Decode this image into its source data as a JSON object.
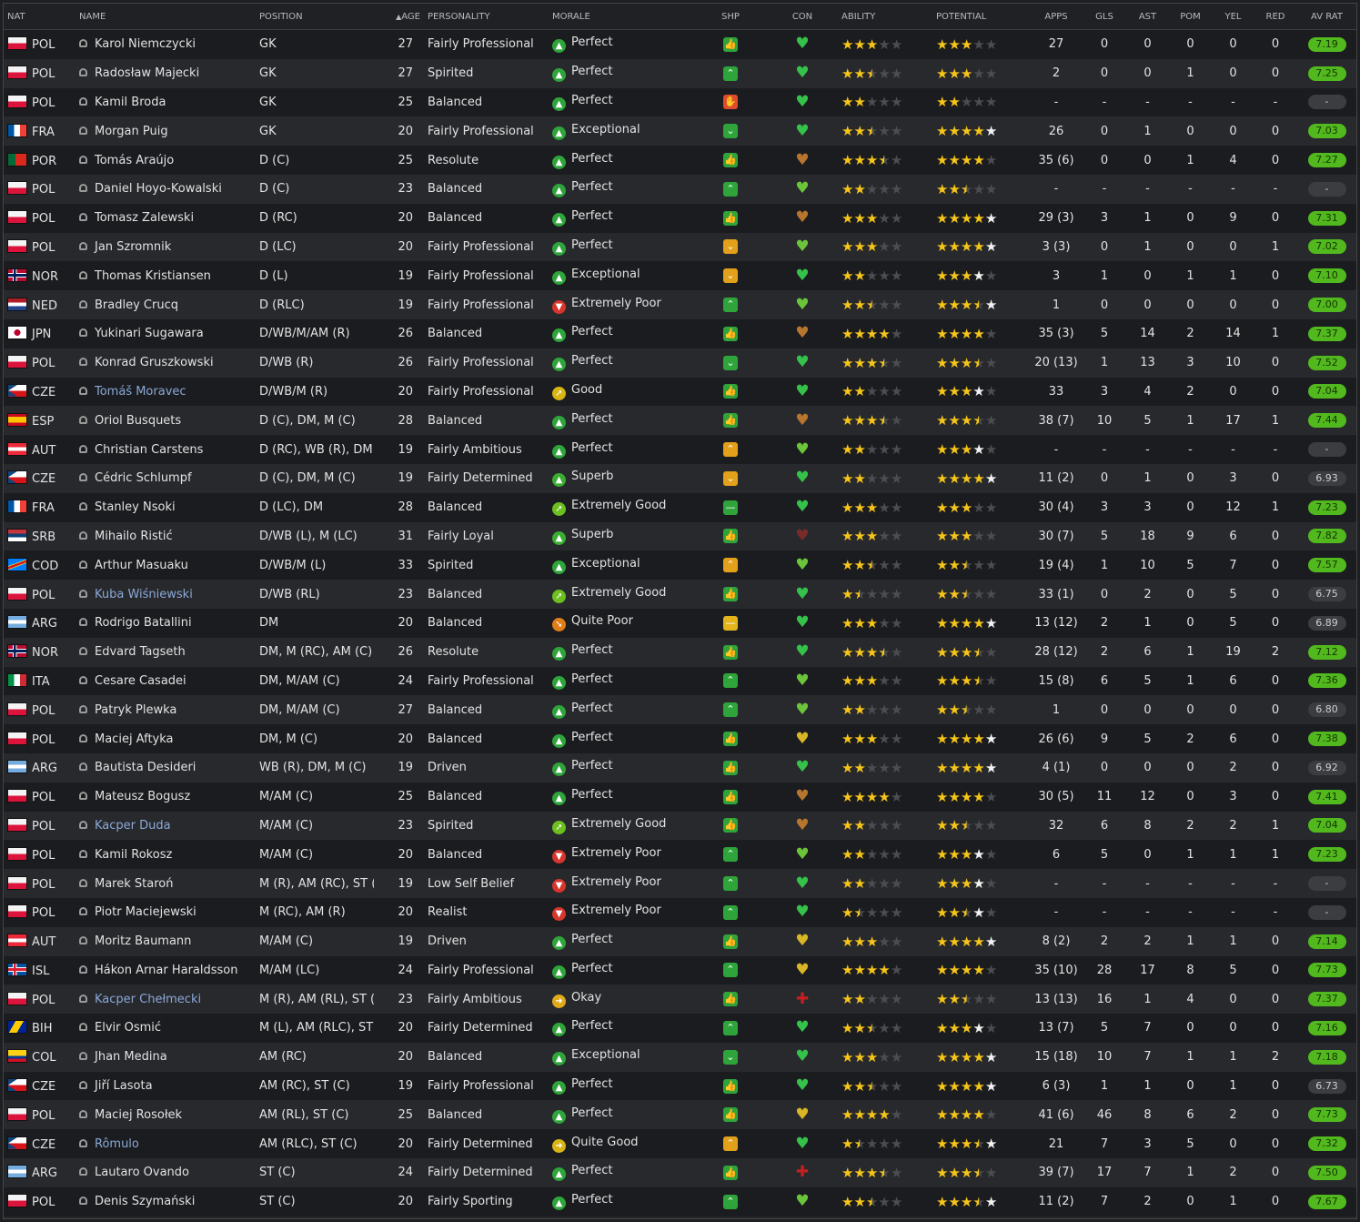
{
  "columns": {
    "nat": "NAT",
    "name": "NAME",
    "position": "POSITION",
    "age_sort_icon": "up-arrow",
    "age": "AGE",
    "personality": "PERSONALITY",
    "morale": "MORALE",
    "shp": "SHP",
    "con": "CON",
    "ability": "ABILITY",
    "potential": "POTENTIAL",
    "apps": "APPS",
    "gls": "GLS",
    "ast": "AST",
    "pom": "POM",
    "yel": "YEL",
    "red": "RED",
    "av_rat": "AV RAT"
  },
  "colors": {
    "accent_green": "#51b81e",
    "star": "#f6c51a",
    "link": "#8aa9d6"
  },
  "players": [
    {
      "nat": "POL",
      "name": "Karol Niemczycki",
      "pos": "GK",
      "age": "27",
      "pers": "Fairly Professional",
      "morale": "Perfect",
      "shp": "thumb",
      "con": "green",
      "ab": 3,
      "pot": 3,
      "pot_w": false,
      "apps": "27",
      "gls": "0",
      "ast": "0",
      "pom": "0",
      "yel": "0",
      "red": "0",
      "av": "7.19"
    },
    {
      "nat": "POL",
      "name": "Radosław Majecki",
      "pos": "GK",
      "age": "27",
      "pers": "Spirited",
      "morale": "Perfect",
      "shp": "up",
      "con": "green",
      "ab": 2.5,
      "pot": 3,
      "pot_w": false,
      "apps": "2",
      "gls": "0",
      "ast": "0",
      "pom": "1",
      "yel": "0",
      "red": "0",
      "av": "7.25"
    },
    {
      "nat": "POL",
      "name": "Kamil Broda",
      "pos": "GK",
      "age": "25",
      "pers": "Balanced",
      "morale": "Perfect",
      "shp": "red",
      "con": "green",
      "ab": 2,
      "pot": 2,
      "pot_w": false,
      "apps": "-",
      "gls": "-",
      "ast": "-",
      "pom": "-",
      "yel": "-",
      "red": "-",
      "av": "-"
    },
    {
      "nat": "FRA",
      "name": "Morgan Puig",
      "pos": "GK",
      "age": "20",
      "pers": "Fairly Professional",
      "morale": "Exceptional",
      "shp": "down",
      "con": "green",
      "ab": 2.5,
      "pot": 4,
      "pot_w": true,
      "apps": "26",
      "gls": "0",
      "ast": "1",
      "pom": "0",
      "yel": "0",
      "red": "0",
      "av": "7.03"
    },
    {
      "nat": "POR",
      "name": "Tomás Araújo",
      "pos": "D (C)",
      "age": "25",
      "pers": "Resolute",
      "morale": "Perfect",
      "shp": "thumb",
      "con": "orange",
      "ab": 3.5,
      "pot": 4,
      "pot_w": false,
      "apps": "35 (6)",
      "gls": "0",
      "ast": "0",
      "pom": "1",
      "yel": "4",
      "red": "0",
      "av": "7.27"
    },
    {
      "nat": "POL",
      "name": "Daniel Hoyo-Kowalski",
      "pos": "D (C)",
      "age": "23",
      "pers": "Balanced",
      "morale": "Perfect",
      "shp": "up",
      "con": "lime",
      "ab": 2,
      "pot": 2.5,
      "pot_w": false,
      "apps": "-",
      "gls": "-",
      "ast": "-",
      "pom": "-",
      "yel": "-",
      "red": "-",
      "av": "-"
    },
    {
      "nat": "POL",
      "name": "Tomasz Zalewski",
      "pos": "D (RC)",
      "age": "20",
      "pers": "Balanced",
      "morale": "Perfect",
      "shp": "thumb",
      "con": "orange",
      "ab": 3,
      "pot": 4,
      "pot_w": true,
      "apps": "29 (3)",
      "gls": "3",
      "ast": "1",
      "pom": "0",
      "yel": "9",
      "red": "0",
      "av": "7.31"
    },
    {
      "nat": "POL",
      "name": "Jan Szromnik",
      "pos": "D (LC)",
      "age": "20",
      "pers": "Fairly Professional",
      "morale": "Perfect",
      "shp": "yellowdown",
      "con": "lime",
      "ab": 3,
      "pot": 4,
      "pot_w": true,
      "apps": "3 (3)",
      "gls": "0",
      "ast": "1",
      "pom": "0",
      "yel": "0",
      "red": "1",
      "av": "7.02"
    },
    {
      "nat": "NOR",
      "name": "Thomas Kristiansen",
      "pos": "D (L)",
      "age": "19",
      "pers": "Fairly Professional",
      "morale": "Exceptional",
      "shp": "yellowdown",
      "con": "green",
      "ab": 2,
      "pot": 3,
      "pot_w": true,
      "apps": "3",
      "gls": "1",
      "ast": "0",
      "pom": "1",
      "yel": "1",
      "red": "0",
      "av": "7.10"
    },
    {
      "nat": "NED",
      "name": "Bradley Crucq",
      "pos": "D (RLC)",
      "age": "19",
      "pers": "Fairly Professional",
      "morale": "Extremely Poor",
      "shp": "up",
      "con": "lime",
      "ab": 2.5,
      "pot": 3.5,
      "pot_w": true,
      "apps": "1",
      "gls": "0",
      "ast": "0",
      "pom": "0",
      "yel": "0",
      "red": "0",
      "av": "7.00"
    },
    {
      "nat": "JPN",
      "name": "Yukinari Sugawara",
      "pos": "D/WB/M/AM (R)",
      "age": "26",
      "pers": "Balanced",
      "morale": "Perfect",
      "shp": "thumb",
      "con": "orange",
      "ab": 4,
      "pot": 4,
      "pot_w": false,
      "apps": "35 (3)",
      "gls": "5",
      "ast": "14",
      "pom": "2",
      "yel": "14",
      "red": "1",
      "av": "7.37"
    },
    {
      "nat": "POL",
      "name": "Konrad Gruszkowski",
      "pos": "D/WB (R)",
      "age": "26",
      "pers": "Fairly Professional",
      "morale": "Perfect",
      "shp": "down",
      "con": "green",
      "ab": 3.5,
      "pot": 3.5,
      "pot_w": false,
      "apps": "20 (13)",
      "gls": "1",
      "ast": "13",
      "pom": "3",
      "yel": "10",
      "red": "0",
      "av": "7.52"
    },
    {
      "nat": "CZE",
      "name": "Tomáš Moravec",
      "link": true,
      "pos": "D/WB/M (R)",
      "age": "20",
      "pers": "Fairly Professional",
      "morale": "Good",
      "shp": "thumb",
      "con": "green",
      "ab": 2,
      "pot": 3,
      "pot_w": true,
      "apps": "33",
      "gls": "3",
      "ast": "4",
      "pom": "2",
      "yel": "0",
      "red": "0",
      "av": "7.04"
    },
    {
      "nat": "ESP",
      "name": "Oriol Busquets",
      "pos": "D (C), DM, M (C)",
      "age": "28",
      "pers": "Balanced",
      "morale": "Perfect",
      "shp": "thumb",
      "con": "orange",
      "ab": 3.5,
      "pot": 3.5,
      "pot_w": false,
      "apps": "38 (7)",
      "gls": "10",
      "ast": "5",
      "pom": "1",
      "yel": "17",
      "red": "1",
      "av": "7.44"
    },
    {
      "nat": "AUT",
      "name": "Christian Carstens",
      "pos": "D (RC), WB (R), DM",
      "age": "19",
      "pers": "Fairly Ambitious",
      "morale": "Perfect",
      "shp": "yellowup",
      "con": "lime",
      "ab": 2,
      "pot": 3,
      "pot_w": true,
      "apps": "-",
      "gls": "-",
      "ast": "-",
      "pom": "-",
      "yel": "-",
      "red": "-",
      "av": "-"
    },
    {
      "nat": "CZE",
      "name": "Cédric Schlumpf",
      "pos": "D (C), DM, M (C)",
      "age": "19",
      "pers": "Fairly Determined",
      "morale": "Superb",
      "shp": "yellowdown",
      "con": "green",
      "ab": 2,
      "pot": 4,
      "pot_w": true,
      "apps": "11 (2)",
      "gls": "0",
      "ast": "1",
      "pom": "0",
      "yel": "3",
      "red": "0",
      "av": "6.93"
    },
    {
      "nat": "FRA",
      "name": "Stanley Nsoki",
      "pos": "D (LC), DM",
      "age": "28",
      "pers": "Balanced",
      "morale": "Extremely Good",
      "shp": "dash",
      "con": "green",
      "ab": 3,
      "pot": 3,
      "pot_w": false,
      "apps": "30 (4)",
      "gls": "3",
      "ast": "3",
      "pom": "0",
      "yel": "12",
      "red": "1",
      "av": "7.23"
    },
    {
      "nat": "SRB",
      "name": "Mihailo Ristić",
      "pos": "D/WB (L), M (LC)",
      "age": "31",
      "pers": "Fairly Loyal",
      "morale": "Superb",
      "shp": "thumb",
      "con": "darkred",
      "ab": 3,
      "pot": 3,
      "pot_w": false,
      "apps": "30 (7)",
      "gls": "5",
      "ast": "18",
      "pom": "9",
      "yel": "6",
      "red": "0",
      "av": "7.82"
    },
    {
      "nat": "COD",
      "name": "Arthur Masuaku",
      "pos": "D/WB/M (L)",
      "age": "33",
      "pers": "Spirited",
      "morale": "Exceptional",
      "shp": "yellowup",
      "con": "lime",
      "ab": 2.5,
      "pot": 2.5,
      "pot_w": false,
      "apps": "19 (4)",
      "gls": "1",
      "ast": "10",
      "pom": "5",
      "yel": "7",
      "red": "0",
      "av": "7.57"
    },
    {
      "nat": "POL",
      "name": "Kuba Wiśniewski",
      "link": true,
      "pos": "D/WB (RL)",
      "age": "23",
      "pers": "Balanced",
      "morale": "Extremely Good",
      "shp": "thumb",
      "con": "green",
      "ab": 1.5,
      "pot": 2.5,
      "pot_w": false,
      "apps": "33 (1)",
      "gls": "0",
      "ast": "2",
      "pom": "0",
      "yel": "5",
      "red": "0",
      "av": "6.75"
    },
    {
      "nat": "ARG",
      "name": "Rodrigo Batallini",
      "pos": "DM",
      "age": "20",
      "pers": "Balanced",
      "morale": "Quite Poor",
      "shp": "yellowdash",
      "con": "green",
      "ab": 3,
      "pot": 4,
      "pot_w": true,
      "apps": "13 (12)",
      "gls": "2",
      "ast": "1",
      "pom": "0",
      "yel": "5",
      "red": "0",
      "av": "6.89"
    },
    {
      "nat": "NOR",
      "name": "Edvard Tagseth",
      "pos": "DM, M (RC), AM (C)",
      "age": "26",
      "pers": "Resolute",
      "morale": "Perfect",
      "shp": "thumb",
      "con": "green",
      "ab": 3.5,
      "pot": 3.5,
      "pot_w": false,
      "apps": "28 (12)",
      "gls": "2",
      "ast": "6",
      "pom": "1",
      "yel": "19",
      "red": "2",
      "av": "7.12"
    },
    {
      "nat": "ITA",
      "name": "Cesare Casadei",
      "pos": "DM, M/AM (C)",
      "age": "24",
      "pers": "Fairly Professional",
      "morale": "Perfect",
      "shp": "up",
      "con": "lime",
      "ab": 3,
      "pot": 3.5,
      "pot_w": false,
      "apps": "15 (8)",
      "gls": "6",
      "ast": "5",
      "pom": "1",
      "yel": "6",
      "red": "0",
      "av": "7.36"
    },
    {
      "nat": "POL",
      "name": "Patryk Plewka",
      "pos": "DM, M/AM (C)",
      "age": "27",
      "pers": "Balanced",
      "morale": "Perfect",
      "shp": "up",
      "con": "lime",
      "ab": 2,
      "pot": 2.5,
      "pot_w": false,
      "apps": "1",
      "gls": "0",
      "ast": "0",
      "pom": "0",
      "yel": "0",
      "red": "0",
      "av": "6.80"
    },
    {
      "nat": "POL",
      "name": "Maciej Aftyka",
      "pos": "DM, M (C)",
      "age": "20",
      "pers": "Balanced",
      "morale": "Perfect",
      "shp": "thumb",
      "con": "yellow",
      "ab": 3,
      "pot": 4,
      "pot_w": true,
      "apps": "26 (6)",
      "gls": "9",
      "ast": "5",
      "pom": "2",
      "yel": "6",
      "red": "0",
      "av": "7.38"
    },
    {
      "nat": "ARG",
      "name": "Bautista Desideri",
      "pos": "WB (R), DM, M (C)",
      "age": "19",
      "pers": "Driven",
      "morale": "Perfect",
      "shp": "thumb",
      "con": "green",
      "ab": 2,
      "pot": 4,
      "pot_w": true,
      "apps": "4 (1)",
      "gls": "0",
      "ast": "0",
      "pom": "0",
      "yel": "2",
      "red": "0",
      "av": "6.92"
    },
    {
      "nat": "POL",
      "name": "Mateusz Bogusz",
      "pos": "M/AM (C)",
      "age": "25",
      "pers": "Balanced",
      "morale": "Perfect",
      "shp": "thumb",
      "con": "orange",
      "ab": 4,
      "pot": 4,
      "pot_w": false,
      "apps": "30 (5)",
      "gls": "11",
      "ast": "12",
      "pom": "0",
      "yel": "3",
      "red": "0",
      "av": "7.41"
    },
    {
      "nat": "POL",
      "name": "Kacper Duda",
      "link": true,
      "pos": "M/AM (C)",
      "age": "23",
      "pers": "Spirited",
      "morale": "Extremely Good",
      "shp": "thumb",
      "con": "orange",
      "ab": 2,
      "pot": 2.5,
      "pot_w": false,
      "apps": "32",
      "gls": "6",
      "ast": "8",
      "pom": "2",
      "yel": "2",
      "red": "1",
      "av": "7.04"
    },
    {
      "nat": "POL",
      "name": "Kamil Rokosz",
      "pos": "M/AM (C)",
      "age": "20",
      "pers": "Balanced",
      "morale": "Extremely Poor",
      "shp": "up",
      "con": "lime",
      "ab": 2,
      "pot": 3,
      "pot_w": true,
      "apps": "6",
      "gls": "5",
      "ast": "0",
      "pom": "1",
      "yel": "1",
      "red": "1",
      "av": "7.23"
    },
    {
      "nat": "POL",
      "name": "Marek Staroń",
      "pos": "M (R), AM (RC), ST (C)",
      "age": "19",
      "pers": "Low Self Belief",
      "morale": "Extremely Poor",
      "shp": "up",
      "con": "green",
      "ab": 2,
      "pot": 3,
      "pot_w": true,
      "apps": "-",
      "gls": "-",
      "ast": "-",
      "pom": "-",
      "yel": "-",
      "red": "-",
      "av": "-"
    },
    {
      "nat": "POL",
      "name": "Piotr Maciejewski",
      "pos": "M (RC), AM (R)",
      "age": "20",
      "pers": "Realist",
      "morale": "Extremely Poor",
      "shp": "up",
      "con": "green",
      "ab": 1.5,
      "pot": 2.5,
      "pot_w": true,
      "apps": "-",
      "gls": "-",
      "ast": "-",
      "pom": "-",
      "yel": "-",
      "red": "-",
      "av": "-"
    },
    {
      "nat": "AUT",
      "name": "Moritz Baumann",
      "pos": "M/AM (C)",
      "age": "19",
      "pers": "Driven",
      "morale": "Perfect",
      "shp": "thumb",
      "con": "yellow",
      "ab": 3,
      "pot": 4,
      "pot_w": true,
      "apps": "8 (2)",
      "gls": "2",
      "ast": "2",
      "pom": "1",
      "yel": "1",
      "red": "0",
      "av": "7.14"
    },
    {
      "nat": "ISL",
      "name": "Hákon Arnar Haraldsson",
      "pos": "M/AM (LC)",
      "age": "24",
      "pers": "Fairly Professional",
      "morale": "Perfect",
      "shp": "up",
      "con": "yellow",
      "ab": 4,
      "pot": 4,
      "pot_w": false,
      "apps": "35 (10)",
      "gls": "28",
      "ast": "17",
      "pom": "8",
      "yel": "5",
      "red": "0",
      "av": "7.73"
    },
    {
      "nat": "POL",
      "name": "Kacper Chełmecki",
      "link": true,
      "pos": "M (R), AM (RL), ST (C)",
      "age": "23",
      "pers": "Fairly Ambitious",
      "morale": "Okay",
      "shp": "thumb",
      "con": "injury",
      "ab": 2,
      "pot": 2.5,
      "pot_w": false,
      "apps": "13 (13)",
      "gls": "16",
      "ast": "1",
      "pom": "4",
      "yel": "0",
      "red": "0",
      "av": "7.37"
    },
    {
      "nat": "BIH",
      "name": "Elvir Osmić",
      "pos": "M (L), AM (RLC), ST (C)",
      "age": "20",
      "pers": "Fairly Determined",
      "morale": "Perfect",
      "shp": "up",
      "con": "green",
      "ab": 2.5,
      "pot": 3,
      "pot_w": true,
      "apps": "13 (7)",
      "gls": "5",
      "ast": "7",
      "pom": "0",
      "yel": "0",
      "red": "0",
      "av": "7.16"
    },
    {
      "nat": "COL",
      "name": "Jhan Medina",
      "pos": "AM (RC)",
      "age": "20",
      "pers": "Balanced",
      "morale": "Exceptional",
      "shp": "down",
      "con": "green",
      "ab": 3,
      "pot": 4,
      "pot_w": true,
      "apps": "15 (18)",
      "gls": "10",
      "ast": "7",
      "pom": "1",
      "yel": "1",
      "red": "2",
      "av": "7.18"
    },
    {
      "nat": "CZE",
      "name": "Jiří Lasota",
      "pos": "AM (RC), ST (C)",
      "age": "19",
      "pers": "Fairly Professional",
      "morale": "Perfect",
      "shp": "thumb",
      "con": "green",
      "ab": 2.5,
      "pot": 4,
      "pot_w": true,
      "apps": "6 (3)",
      "gls": "1",
      "ast": "1",
      "pom": "0",
      "yel": "1",
      "red": "0",
      "av": "6.73"
    },
    {
      "nat": "POL",
      "name": "Maciej Rosołek",
      "pos": "AM (RL), ST (C)",
      "age": "25",
      "pers": "Balanced",
      "morale": "Perfect",
      "shp": "thumb",
      "con": "yellow",
      "ab": 4,
      "pot": 4,
      "pot_w": false,
      "apps": "41 (6)",
      "gls": "46",
      "ast": "8",
      "pom": "6",
      "yel": "2",
      "red": "0",
      "av": "7.73"
    },
    {
      "nat": "CZE",
      "name": "Rômulo",
      "link": true,
      "pos": "AM (RLC), ST (C)",
      "age": "20",
      "pers": "Fairly Determined",
      "morale": "Quite Good",
      "shp": "yellowup",
      "con": "green",
      "ab": 1.5,
      "pot": 3.5,
      "pot_w": true,
      "apps": "21",
      "gls": "7",
      "ast": "3",
      "pom": "5",
      "yel": "0",
      "red": "0",
      "av": "7.32"
    },
    {
      "nat": "ARG",
      "name": "Lautaro Ovando",
      "pos": "ST (C)",
      "age": "24",
      "pers": "Fairly Determined",
      "morale": "Perfect",
      "shp": "thumb",
      "con": "injury",
      "ab": 3.5,
      "pot": 3.5,
      "pot_w": false,
      "apps": "39 (7)",
      "gls": "17",
      "ast": "7",
      "pom": "1",
      "yel": "2",
      "red": "0",
      "av": "7.50"
    },
    {
      "nat": "POL",
      "name": "Denis Szymański",
      "pos": "ST (C)",
      "age": "20",
      "pers": "Fairly Sporting",
      "morale": "Perfect",
      "shp": "up",
      "con": "lime",
      "ab": 2.5,
      "pot": 3.5,
      "pot_w": true,
      "apps": "11 (2)",
      "gls": "7",
      "ast": "2",
      "pom": "0",
      "yel": "1",
      "red": "0",
      "av": "7.67"
    }
  ]
}
